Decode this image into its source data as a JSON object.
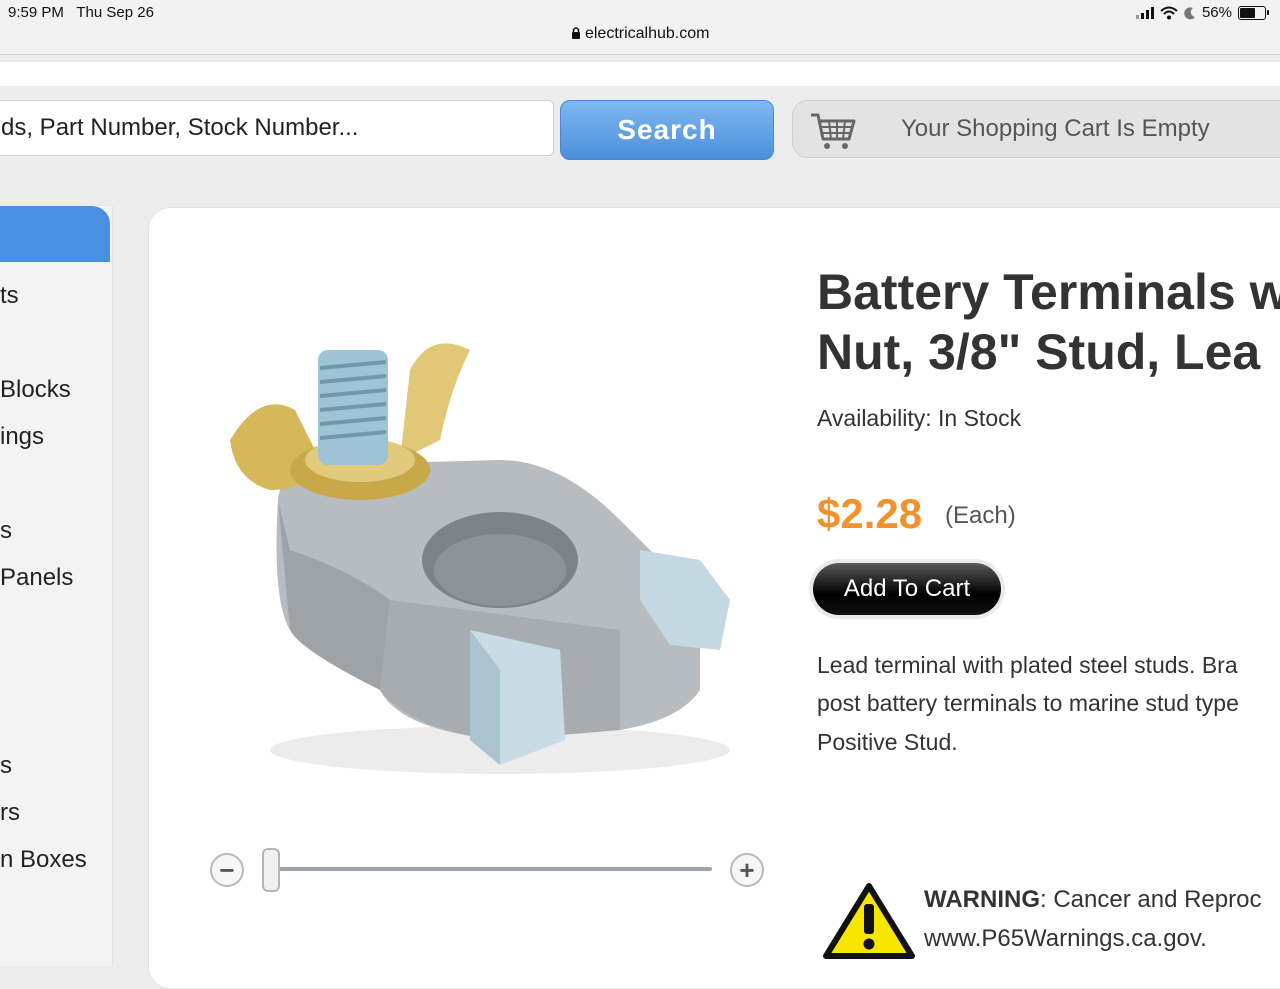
{
  "status_bar": {
    "time": "9:59 PM",
    "date": "Thu Sep 26",
    "battery": "56%",
    "url": "electricalhub.com"
  },
  "search": {
    "query": "ds, Part Number, Stock Number...",
    "button_label": "Search"
  },
  "cart": {
    "label": "Your Shopping Cart Is Empty"
  },
  "sidebar": {
    "items": [
      {
        "label": "ts"
      },
      {
        "label": " Blocks"
      },
      {
        "label": "ings"
      },
      {
        "label": "s"
      },
      {
        "label": "Panels"
      },
      {
        "label": "s"
      },
      {
        "label": "rs"
      },
      {
        "label": "n Boxes"
      }
    ]
  },
  "product": {
    "title_line1": "Battery Terminals w",
    "title_line2": "Nut, 3/8\" Stud, Lea",
    "availability": "Availability: In Stock",
    "price": "$2.28",
    "price_unit": "(Each)",
    "add_to_cart_label": "Add To Cart",
    "description_lines": [
      "Lead terminal with plated steel studs. Bra",
      "post battery terminals to marine stud type",
      "Positive Stud."
    ]
  },
  "zoom": {
    "minus_label": "−",
    "plus_label": "+",
    "level": 0
  },
  "warning": {
    "label": "WARNING",
    "text": ": Cancer and Reproc",
    "link": "www.P65Warnings.ca.gov."
  },
  "colors": {
    "accent_blue": "#4a90e2",
    "price_orange": "#f0932e"
  },
  "icons": {
    "cart": "shopping-cart-icon",
    "warning": "warning-triangle-icon",
    "lock": "lock-icon",
    "wifi": "wifi-icon",
    "moon": "moon-icon"
  }
}
